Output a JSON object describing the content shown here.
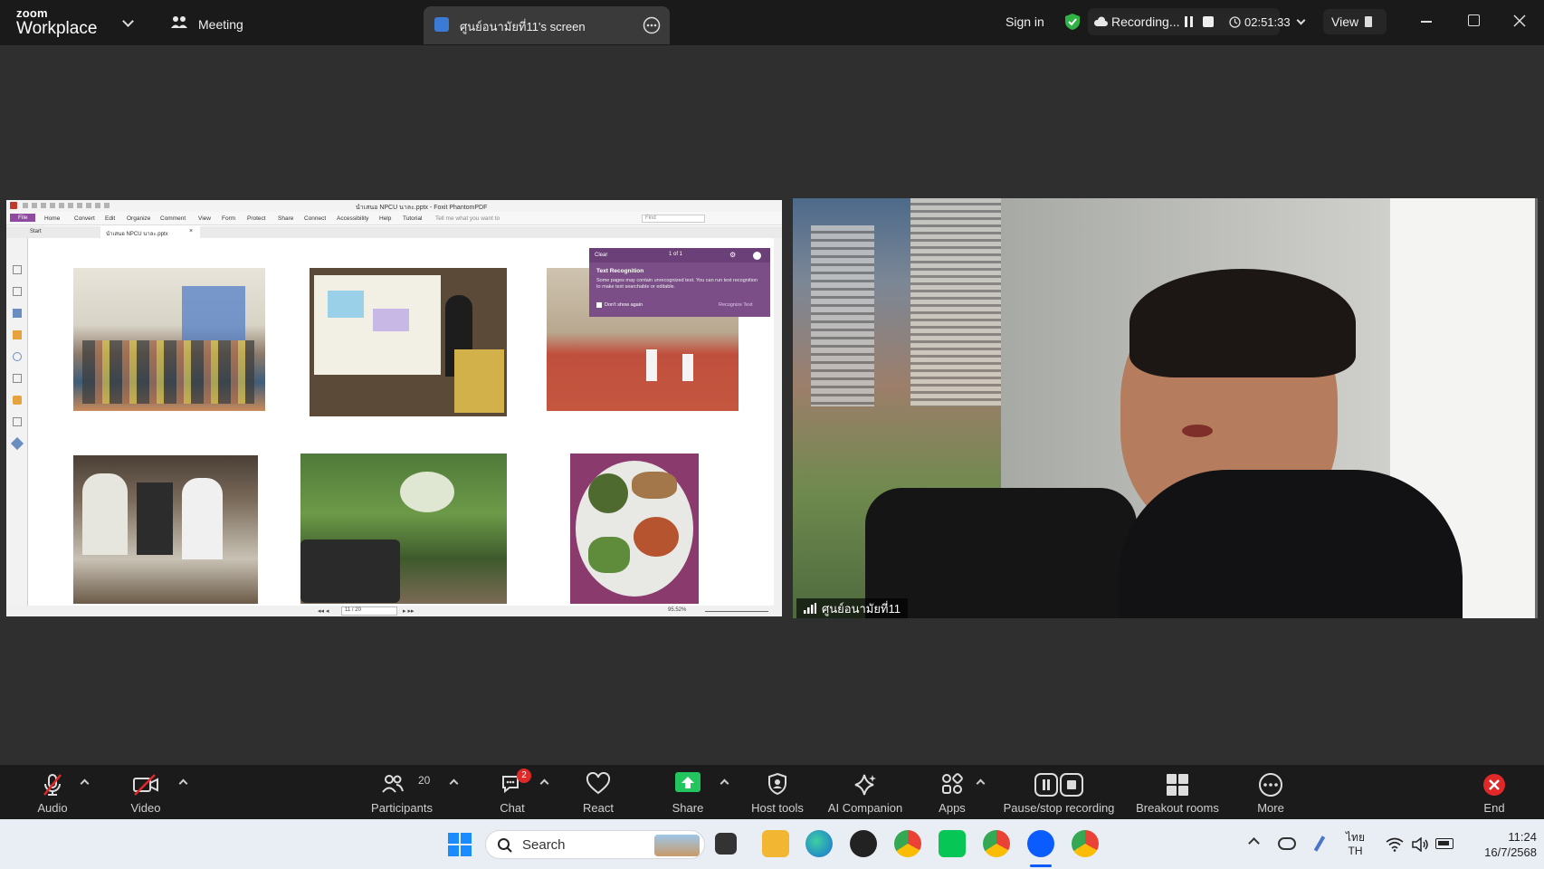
{
  "app": {
    "brand_top": "zoom",
    "brand_bottom": "Workplace"
  },
  "header": {
    "meeting_label": "Meeting",
    "screen_tab_label": "ศูนย์อนามัยที่11's screen",
    "sign_in": "Sign in",
    "recording_label": "Recording...",
    "timer": "02:51:33",
    "view_label": "View"
  },
  "shared_screen": {
    "window_title": "นำเสนอ NPCU นาละ.pptx - Foxit PhantomPDF",
    "menu": [
      "File",
      "Home",
      "Convert",
      "Edit",
      "Organize",
      "Comment",
      "View",
      "Form",
      "Protect",
      "Share",
      "Connect",
      "Accessibility",
      "Help",
      "Tutorial"
    ],
    "tell_me": "Tell me what you want to",
    "find_placeholder": "Find",
    "tabs": [
      "Start",
      "นำเสนอ NPCU นาละ.pptx"
    ],
    "ocr_popup": {
      "clear": "Clear",
      "pager": "1 of 1",
      "title": "Text Recognition",
      "body": "Some pages may contain unrecognized text. You can run text recognition to make text searchable or editable.",
      "dont_show": "Don't show again",
      "action": "Recognize Text"
    },
    "page_indicator": "11 / 20",
    "zoom": "95.52%"
  },
  "video": {
    "participant_name": "ศูนย์อนามัยที่11"
  },
  "toolbar": {
    "audio": "Audio",
    "video": "Video",
    "participants": "Participants",
    "participants_count": "20",
    "chat": "Chat",
    "chat_badge": "2",
    "react": "React",
    "share": "Share",
    "host_tools": "Host tools",
    "ai_companion": "AI Companion",
    "apps": "Apps",
    "pause_stop": "Pause/stop recording",
    "breakout": "Breakout rooms",
    "more": "More",
    "end": "End"
  },
  "taskbar": {
    "search": "Search",
    "lang_top": "ไทย",
    "lang_bottom": "TH",
    "time": "11:24",
    "date": "16/7/2568"
  },
  "colors": {
    "zoom_blue": "#0b5cff",
    "share_green": "#22c55e",
    "end_red": "#e02828",
    "ocr_purple": "#7b4e88",
    "shield_green": "#2fb344"
  }
}
